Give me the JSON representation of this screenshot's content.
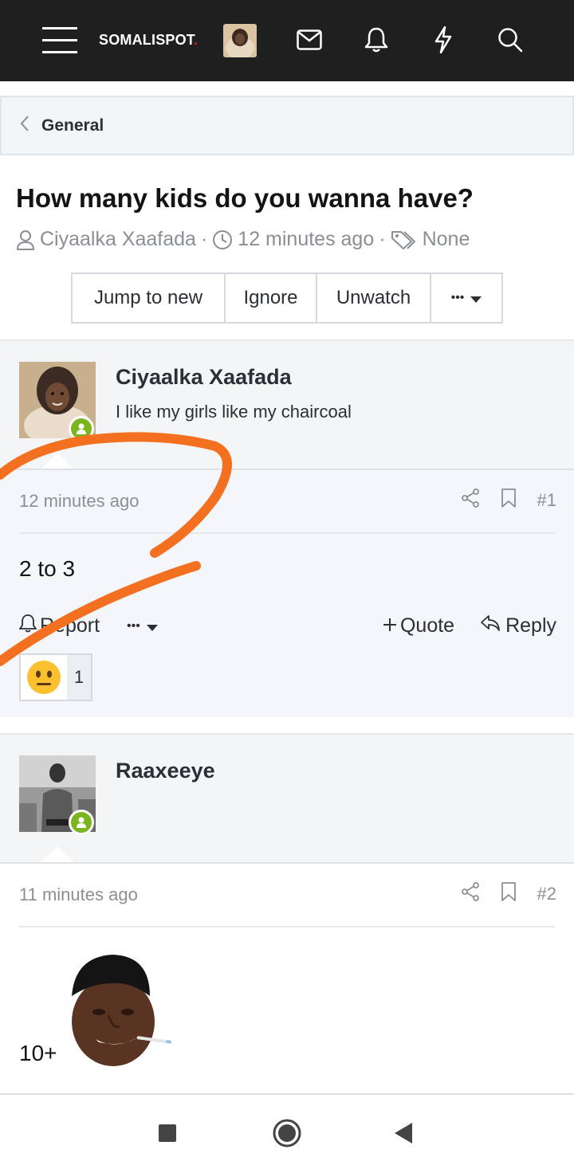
{
  "nav": {
    "brand": "SOMALISPOT",
    "brand_dot": ".",
    "icons": [
      "menu-icon",
      "avatar",
      "envelope-icon",
      "bell-icon",
      "lightning-icon",
      "search-icon"
    ]
  },
  "breadcrumb": {
    "label": "General"
  },
  "thread": {
    "title": "How many kids do you wanna have?",
    "author": "Ciyaalka Xaafada",
    "time": "12 minutes ago",
    "tags": "None",
    "sep": "·"
  },
  "actions": {
    "jump": "Jump to new",
    "ignore": "Ignore",
    "unwatch": "Unwatch",
    "more": "•••"
  },
  "posts": [
    {
      "username": "Ciyaalka Xaafada",
      "user_title": "I like my girls like my chaircoal",
      "time": "12 minutes ago",
      "number": "#1",
      "content": "2 to 3",
      "report": "Report",
      "more": "•••",
      "quote": "Quote",
      "reply": "Reply",
      "reaction_count": "1"
    },
    {
      "username": "Raaxeeye",
      "time": "11 minutes ago",
      "number": "#2",
      "content": "10+"
    }
  ],
  "colors": {
    "nav_bg": "#1f1f1f",
    "online": "#7bb51e",
    "annotation": "#f37021"
  }
}
